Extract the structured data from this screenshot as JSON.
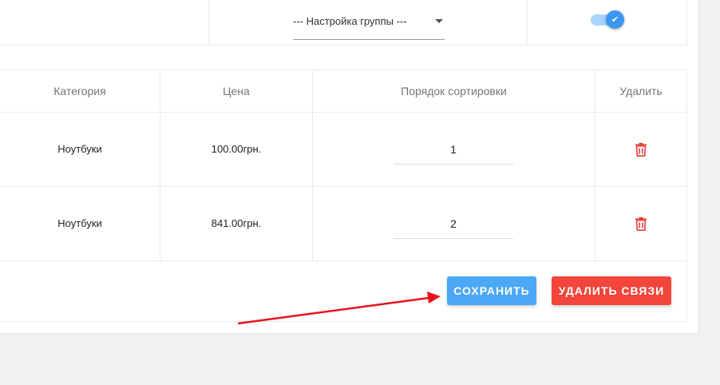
{
  "settings_row": {
    "group_select": {
      "value": "--- Настройка группы ---"
    },
    "toggle": {
      "state": "on",
      "icon": "check-icon",
      "color": "#3c97f0"
    }
  },
  "table": {
    "columns": [
      "Категория",
      "Цена",
      "Порядок сортировки",
      "Удалить"
    ],
    "rows": [
      {
        "category": "Ноутбуки",
        "price": "100.00грн.",
        "sort_order": "1",
        "delete_icon": "trash-icon"
      },
      {
        "category": "Ноутбуки",
        "price": "841.00грн.",
        "sort_order": "2",
        "delete_icon": "trash-icon"
      }
    ]
  },
  "actions": {
    "save_label": "СОХРАНИТЬ",
    "delete_links_label": "УДАЛИТЬ СВЯЗИ"
  },
  "colors": {
    "save_button": "#4aa8f7",
    "delete_button": "#f2453b",
    "trash_icon": "#e53935",
    "annotation_arrow": "#e8141a"
  },
  "annotation": {
    "type": "arrow",
    "points_to": "save-button"
  }
}
